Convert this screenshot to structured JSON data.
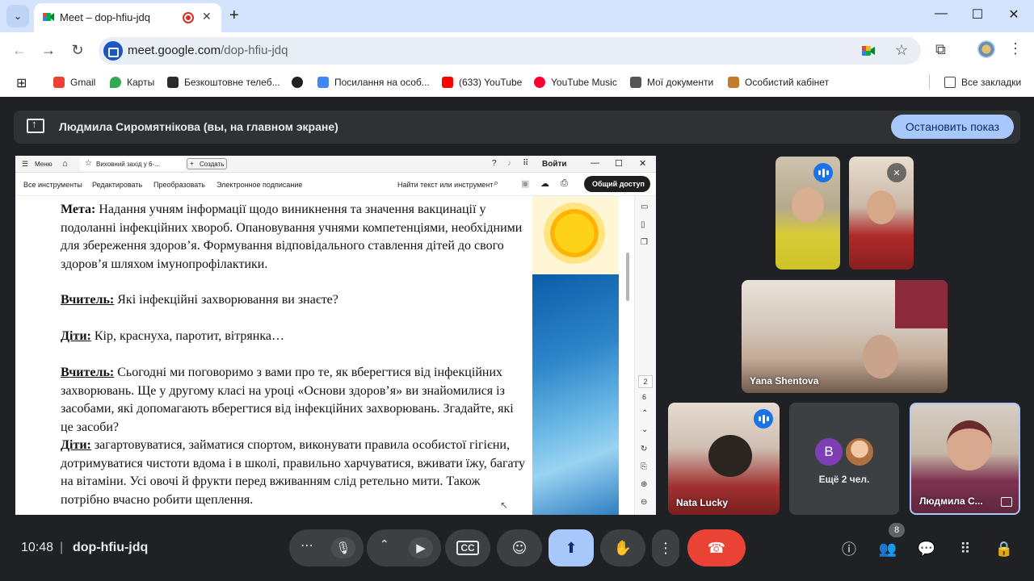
{
  "browser": {
    "tab_title": "Meet – dop-hfiu-jdq",
    "new_tab": "+",
    "url_host": "meet.google.com",
    "url_path": "/dop-hfiu-jdq"
  },
  "bookmarks": [
    {
      "label": "Gmail",
      "color": "#ea4335"
    },
    {
      "label": "Карты",
      "color": "#34a853"
    },
    {
      "label": "Безкоштовне телеб...",
      "color": "#2b2b2b"
    },
    {
      "label": "",
      "color": "#202124"
    },
    {
      "label": "Посилання на особ...",
      "color": "#4285f4"
    },
    {
      "label": "(633) YouTube",
      "color": "#ff0000"
    },
    {
      "label": "YouTube Music",
      "color": "#ff0033"
    },
    {
      "label": "Мої документи",
      "color": "#555555"
    },
    {
      "label": "Особистий кабінет",
      "color": "#c27c2c"
    }
  ],
  "all_bookmarks": "Все закладки",
  "meet": {
    "presenter_banner": "Людмила Сиромятнікова (вы, на главном экране)",
    "stop_presenting": "Остановить показ",
    "clock": "10:48",
    "separator": "|",
    "meeting_code": "dop-hfiu-jdq",
    "people_count": "8"
  },
  "shared_app": {
    "menu": "Меню",
    "doc_tab": "Виховний захід у 6-...",
    "create": "Создать",
    "signin": "Войти",
    "tools": [
      "Все инструменты",
      "Редактировать",
      "Преобразовать",
      "Электронное подписание"
    ],
    "find": "Найти текст или инструмент",
    "share": "Общий доступ",
    "page_current": "2",
    "page_total": "6"
  },
  "document": {
    "p1_label": "Мета:",
    "p1_text": " Надання учням інформації щодо виникнення та значення вакцинації у подоланні інфекційних хвороб. Опановування учнями компетенціями, необхідними для збереження здоров’я. Формування відповідального ставлення дітей до свого здоров’я шляхом імунопрофілактики.",
    "p2_label": "Вчитель:",
    "p2_text": " Які інфекційні захворювання ви знаєте?",
    "p3_label": "Діти:",
    "p3_text": " Кір, краснуха, паротит, вітрянка…",
    "p4_label": "Вчитель:",
    "p4_text": " Сьогодні ми поговоримо з вами про те, як вберегтися від інфекційних захворювань. Ще у другому класі на уроці «Основи здоров’я» ви знайомилися із засобами, які допомагають вберегтися від інфекційних захворювань. Згадайте, які це засоби?",
    "p5_label": "Діти:",
    "p5_text": " загартовуватися, займатися спортом, виконувати правила особистої гігієни, дотримуватися чистоти вдома і в школі, правильно харчуватися, вживати їжу, багату на вітаміни. Усі овочі й фрукти перед вживанням слід ретельно мити. Також потрібно вчасно робити щеплення."
  },
  "participants": {
    "yana": "Yana Shentova",
    "nata": "Nata Lucky",
    "more_initial": "B",
    "more_label": "Ещё 2 чел.",
    "self": "Людмила С..."
  }
}
